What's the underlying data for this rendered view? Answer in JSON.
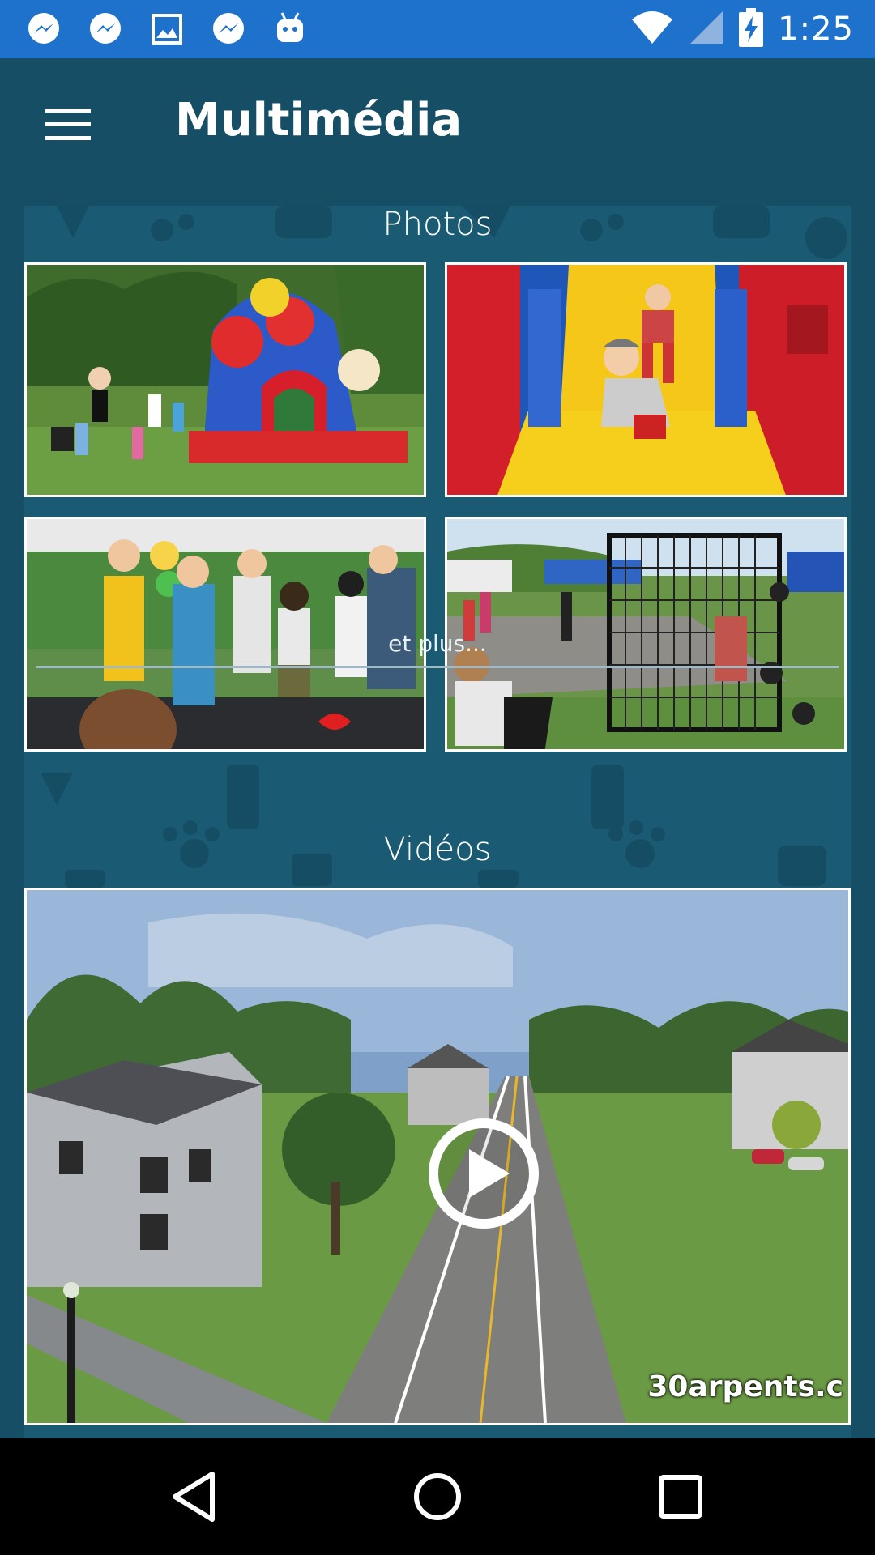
{
  "status_bar": {
    "time": "1:25",
    "notification_icons": [
      "messenger-icon",
      "messenger-icon",
      "image-icon",
      "messenger-icon",
      "android-icon"
    ],
    "system_icons": [
      "wifi-icon",
      "signal-icon",
      "battery-charging-icon"
    ]
  },
  "app_bar": {
    "title": "Multimédia",
    "menu_icon": "hamburger-menu-icon"
  },
  "photos": {
    "title": "Photos",
    "items": [
      {
        "alt": "bouncy castle"
      },
      {
        "alt": "inflatable slide"
      },
      {
        "alt": "kids dancing"
      },
      {
        "alt": "dunk tank"
      }
    ],
    "more_label": "et plus..."
  },
  "videos": {
    "title": "Vidéos",
    "watermark": "30arpents.c",
    "play_icon": "play-icon"
  },
  "nav_bar": {
    "icons": [
      "back-icon",
      "home-icon",
      "recents-icon"
    ]
  },
  "colors": {
    "status_bar": "#1e72cc",
    "app_bar": "#164e66",
    "content_bg": "#1a5a73",
    "accent": "#ffffff"
  }
}
